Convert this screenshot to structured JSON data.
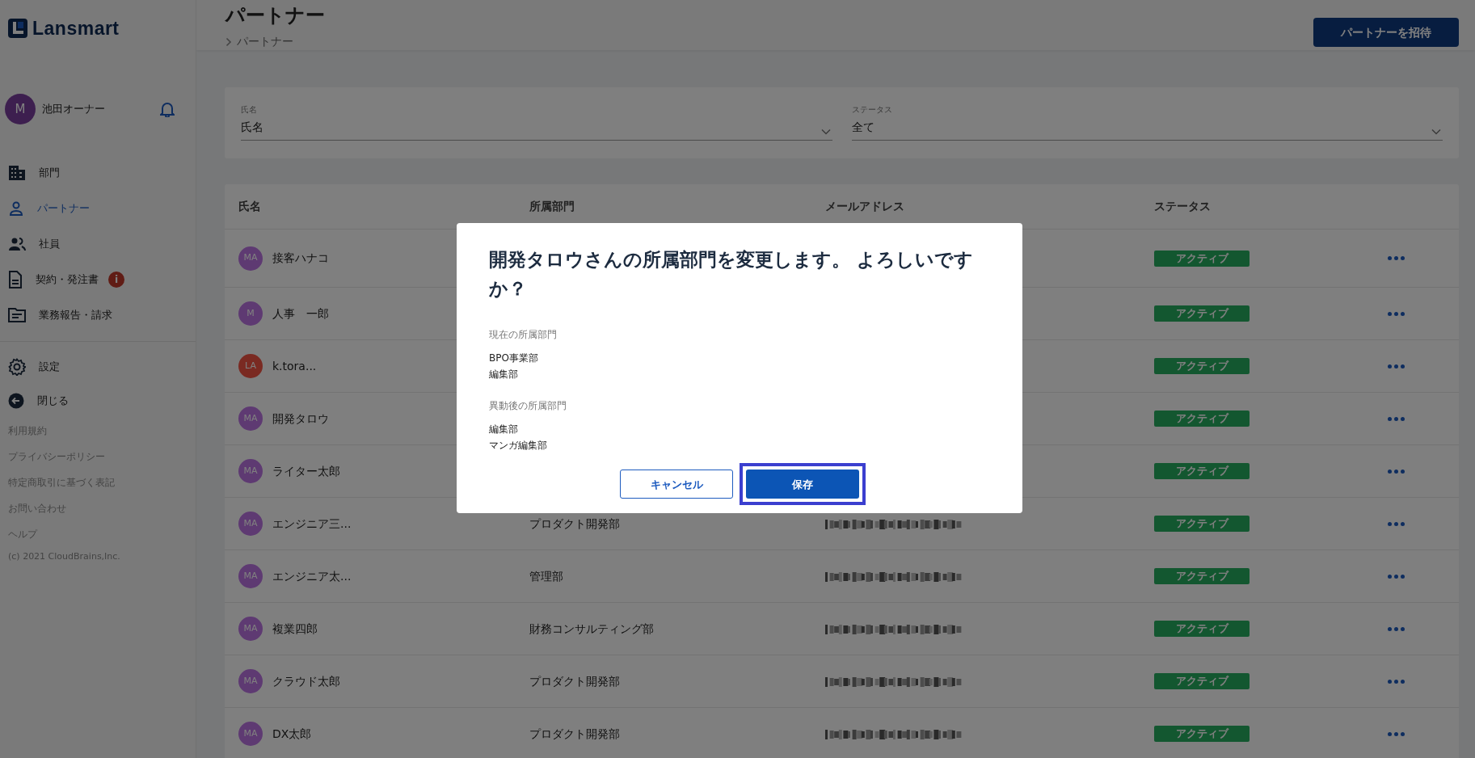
{
  "app": {
    "logo": "Lansmart"
  },
  "user": {
    "avatar": "M",
    "name": "池田オーナー"
  },
  "nav": [
    {
      "label": "部門",
      "selected": false
    },
    {
      "label": "パートナー",
      "selected": true
    },
    {
      "label": "社員",
      "selected": false
    },
    {
      "label": "契約・発注書",
      "selected": false,
      "alert": "i"
    },
    {
      "label": "業務報告・請求",
      "selected": false
    }
  ],
  "secondary_nav": [
    {
      "label": "設定"
    },
    {
      "label": "閉じる"
    }
  ],
  "footer_links": [
    "利用規約",
    "プライバシーポリシー",
    "特定商取引に基づく表記",
    "お問い合わせ",
    "ヘルプ"
  ],
  "copyright": "(c) 2021 CloudBrains,Inc.",
  "page": {
    "title": "パートナー",
    "breadcrumb": "パートナー",
    "invite_button": "パートナーを招待"
  },
  "filters": [
    {
      "label": "氏名",
      "value": "氏名"
    },
    {
      "label": "ステータス",
      "value": "全て"
    }
  ],
  "table": {
    "columns": [
      "氏名",
      "所属部門",
      "メールアドレス",
      "ステータス"
    ],
    "rows": [
      {
        "kind": "covered",
        "avatar": "MA",
        "color": "#5e3a72",
        "name": "接客ハナコ",
        "status": "アクティブ"
      },
      {
        "kind": "covered",
        "avatar": "M",
        "color": "#5e3a72",
        "name": "人事　一郎",
        "status": "アクティブ"
      },
      {
        "kind": "covered",
        "avatar": "LA",
        "color": "#7a2a22",
        "name": "k.tora...",
        "status": "アクティブ"
      },
      {
        "kind": "covered",
        "avatar": "MA",
        "color": "#5e3a72",
        "name": "開発タロウ",
        "status": "アクティブ"
      },
      {
        "kind": "covered",
        "avatar": "MA",
        "color": "#5e3a72",
        "name": "ライター太郎",
        "status": "アクティブ"
      },
      {
        "kind": "full",
        "avatar": "MA",
        "color": "#5e3a72",
        "name": "エンジニア三...",
        "department": "プロダクト開発部",
        "status": "アクティブ"
      },
      {
        "kind": "full",
        "avatar": "MA",
        "color": "#5e3a72",
        "name": "エンジニア太...",
        "department": "管理部",
        "status": "アクティブ"
      },
      {
        "kind": "full",
        "avatar": "MA",
        "color": "#5e3a72",
        "name": "複業四郎",
        "department": "財務コンサルティング部",
        "status": "アクティブ"
      },
      {
        "kind": "full",
        "avatar": "MA",
        "color": "#5e3a72",
        "name": "クラウド太郎",
        "department": "プロダクト開発部",
        "status": "アクティブ"
      },
      {
        "kind": "full",
        "avatar": "MA",
        "color": "#5e3a72",
        "name": "DX太郎",
        "department": "プロダクト開発部",
        "status": "アクティブ"
      }
    ]
  },
  "dialog": {
    "title": "開発タロウさんの所属部門を変更します。 よろしいですか？",
    "sections": [
      {
        "label": "現在の所属部門",
        "items": [
          "BPO事業部",
          "編集部"
        ]
      },
      {
        "label": "異動後の所属部門",
        "items": [
          "編集部",
          "マンガ編集部"
        ]
      }
    ],
    "buttons": [
      {
        "label": "キャンセル",
        "kind": "outline",
        "focused": false
      },
      {
        "label": "保存",
        "kind": "primary",
        "focused": true
      }
    ]
  }
}
